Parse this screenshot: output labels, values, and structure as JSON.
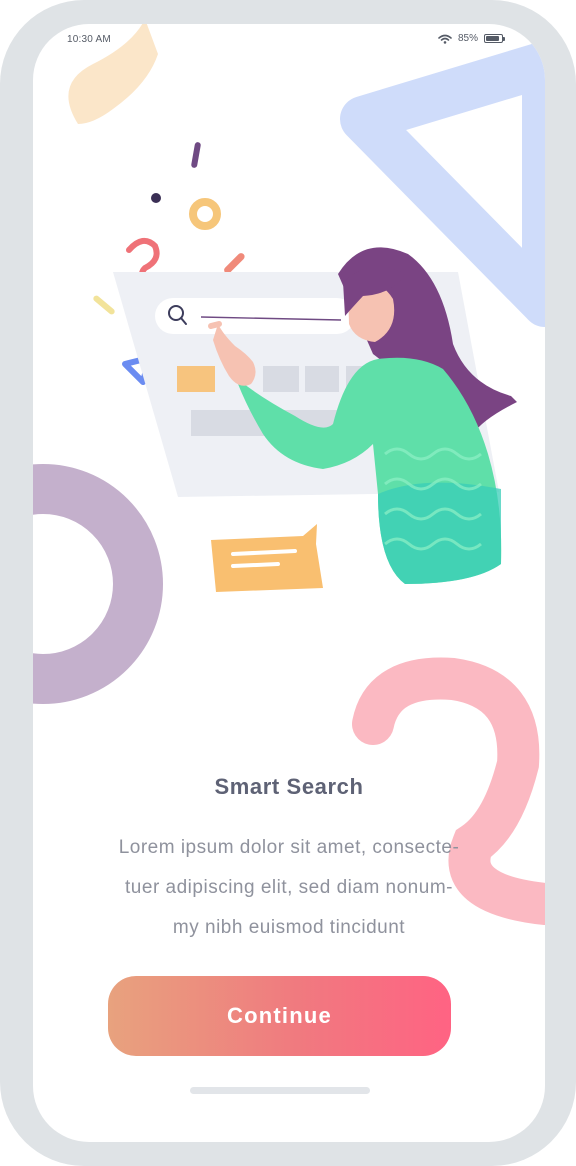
{
  "status_bar": {
    "time": "10:30 AM",
    "battery_percent": "85%",
    "battery_level": 0.85,
    "icons": [
      "wifi-icon",
      "battery-icon"
    ]
  },
  "illustration": {
    "subject": "woman-pointing-at-search-bar",
    "icons": [
      "search-icon",
      "chat-bubble-icon"
    ]
  },
  "onboarding": {
    "title": "Smart Search",
    "description_lines": [
      "Lorem ipsum dolor sit amet, consecte-",
      "tuer adipiscing elit, sed diam nonum-",
      "my nibh euismod tincidunt"
    ],
    "continue_label": "Continue"
  },
  "colors": {
    "button_gradient_start": "#e8a27e",
    "button_gradient_end": "#ff6383",
    "title": "#5e6275",
    "body_text": "#8f929d",
    "frame": "#dfe3e6"
  }
}
